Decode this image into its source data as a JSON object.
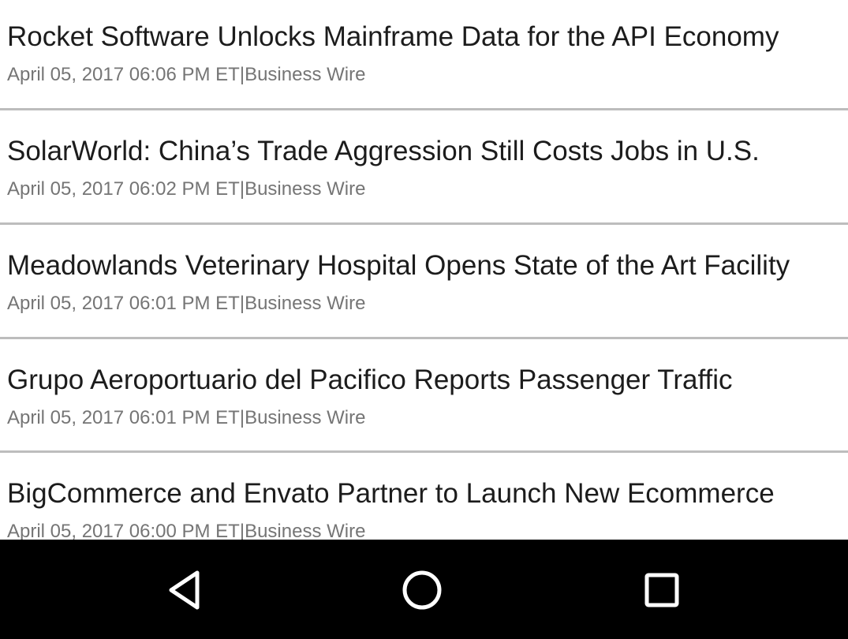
{
  "news": {
    "items": [
      {
        "title": "Rocket Software Unlocks Mainframe Data for the API Economy",
        "date": "April 05, 2017 06:06 PM ET",
        "separator": "|",
        "source": "Business Wire"
      },
      {
        "title": "SolarWorld: China’s Trade Aggression Still Costs Jobs in U.S.",
        "date": "April 05, 2017 06:02 PM ET",
        "separator": "|",
        "source": "Business Wire"
      },
      {
        "title": "Meadowlands Veterinary Hospital Opens State of the Art Facility",
        "date": "April 05, 2017 06:01 PM ET",
        "separator": "|",
        "source": "Business Wire"
      },
      {
        "title": "Grupo Aeroportuario del Pacifico Reports Passenger Traffic",
        "date": "April 05, 2017 06:01 PM ET",
        "separator": "|",
        "source": "Business Wire"
      },
      {
        "title": "BigCommerce and Envato Partner to Launch New Ecommerce",
        "date": "April 05, 2017 06:00 PM ET",
        "separator": "|",
        "source": "Business Wire"
      }
    ]
  },
  "navigation_bar": {
    "back_icon": "back-triangle-icon",
    "home_icon": "home-circle-icon",
    "recents_icon": "recents-square-icon"
  },
  "colors": {
    "title_text": "#1c1c1c",
    "meta_text": "#757575",
    "divider": "#bdbdbd",
    "nav_background": "#000000",
    "nav_icons": "#ffffff"
  }
}
